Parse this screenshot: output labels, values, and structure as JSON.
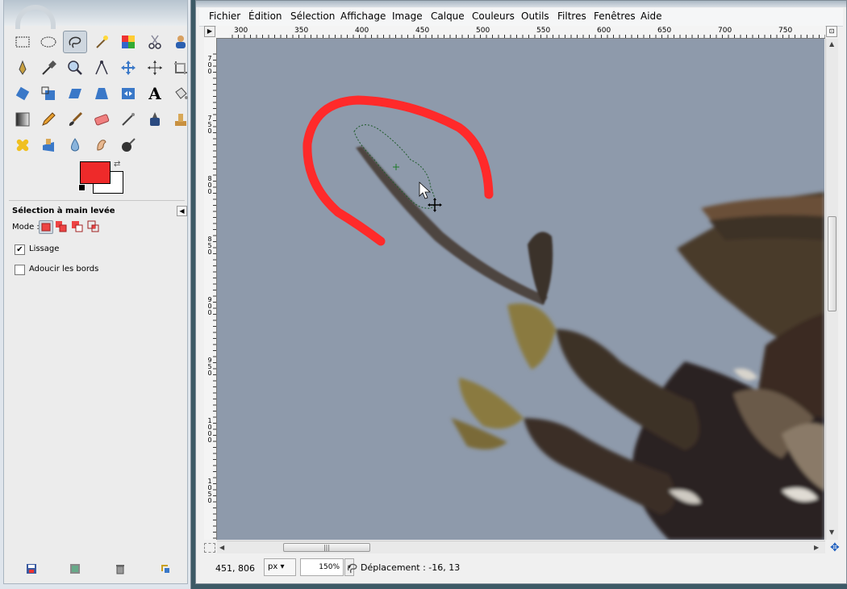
{
  "toolbox": {
    "tools": [
      {
        "name": "rect-select-icon"
      },
      {
        "name": "ellipse-select-icon"
      },
      {
        "name": "free-select-icon",
        "active": true
      },
      {
        "name": "fuzzy-select-icon"
      },
      {
        "name": "color-select-icon"
      },
      {
        "name": "scissors-select-icon"
      },
      {
        "name": "foreground-select-icon"
      },
      {
        "name": "paths-icon"
      },
      {
        "name": "color-picker-icon"
      },
      {
        "name": "zoom-icon"
      },
      {
        "name": "measure-icon"
      },
      {
        "name": "move-icon"
      },
      {
        "name": "align-icon"
      },
      {
        "name": "crop-icon"
      },
      {
        "name": "rotate-icon"
      },
      {
        "name": "scale-icon"
      },
      {
        "name": "shear-icon"
      },
      {
        "name": "perspective-icon"
      },
      {
        "name": "flip-icon"
      },
      {
        "name": "text-icon"
      },
      {
        "name": "bucket-fill-icon"
      },
      {
        "name": "blend-icon"
      },
      {
        "name": "pencil-icon"
      },
      {
        "name": "paintbrush-icon"
      },
      {
        "name": "eraser-icon"
      },
      {
        "name": "airbrush-icon"
      },
      {
        "name": "ink-icon"
      },
      {
        "name": "clone-icon"
      },
      {
        "name": "heal-icon"
      },
      {
        "name": "perspective-clone-icon"
      },
      {
        "name": "blur-icon"
      },
      {
        "name": "smudge-icon"
      },
      {
        "name": "dodge-burn-icon"
      }
    ],
    "fg_color": "#ee2a2a",
    "bg_color": "#ffffff",
    "options_title": "Sélection à main levée",
    "mode_label": "Mode :",
    "antialias_label": "Lissage",
    "antialias_checked": true,
    "feather_label": "Adoucir les bords",
    "feather_checked": false
  },
  "menubar": [
    {
      "label": "Fichier"
    },
    {
      "label": "Édition"
    },
    {
      "label": "Sélection"
    },
    {
      "label": "Affichage"
    },
    {
      "label": "Image"
    },
    {
      "label": "Calque"
    },
    {
      "label": "Couleurs"
    },
    {
      "label": "Outils"
    },
    {
      "label": "Filtres"
    },
    {
      "label": "Fenêtres"
    },
    {
      "label": "Aide"
    }
  ],
  "hruler": [
    "300",
    "350",
    "400",
    "450",
    "500",
    "550",
    "600",
    "650",
    "700",
    "750"
  ],
  "vruler": [
    "700",
    "750",
    "800",
    "850",
    "900",
    "950",
    "1000",
    "1050"
  ],
  "canvas": {
    "background_color": "#8e9aab",
    "stroke_color": "#ff2a2a"
  },
  "statusbar": {
    "coords": "451, 806",
    "unit": "px",
    "zoom": "150%",
    "message": "Déplacement : -16, 13"
  }
}
